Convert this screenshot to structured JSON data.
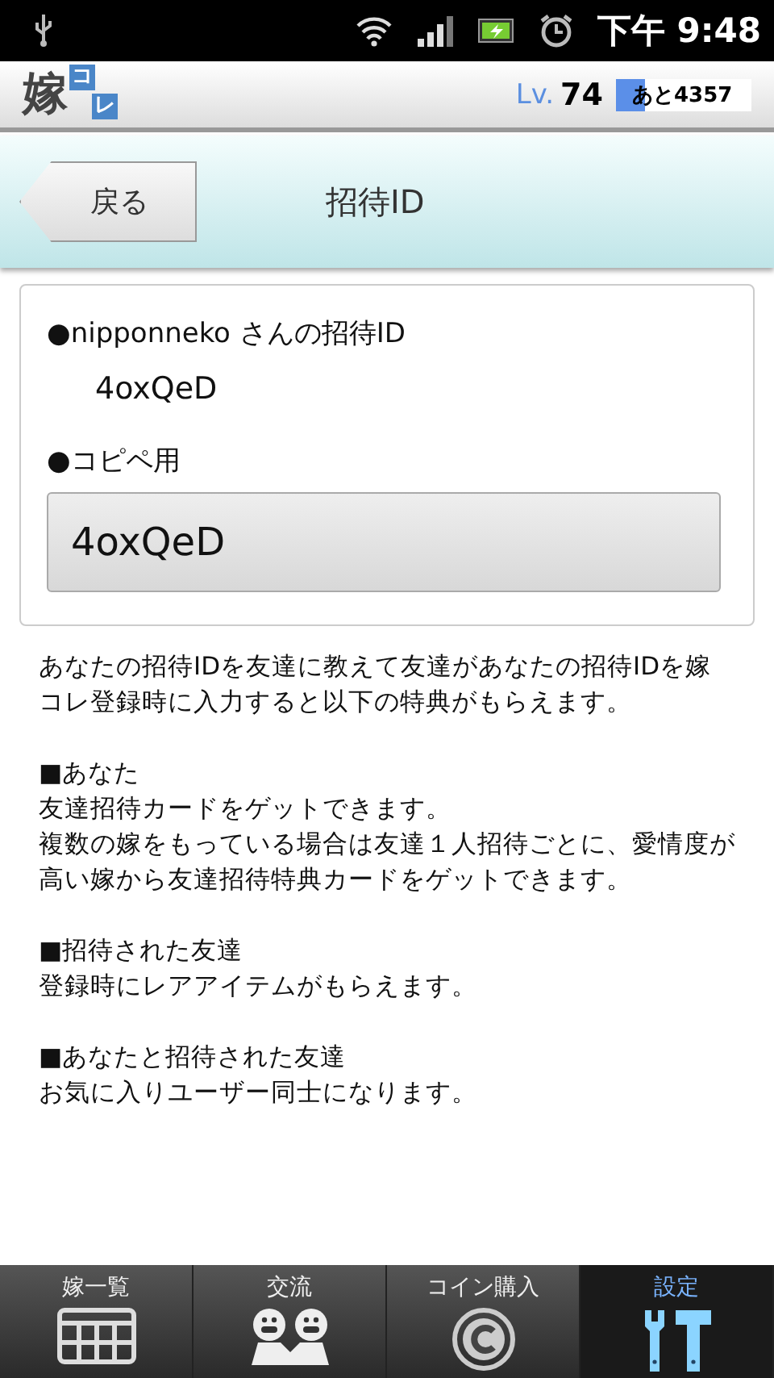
{
  "status_bar": {
    "time": "下午 9:48"
  },
  "header": {
    "logo_main": "嫁",
    "logo_tiles": [
      "コ",
      "レ"
    ],
    "level_label": "Lv.",
    "level_value": "74",
    "exp": {
      "text": "あと4357",
      "level": 0.22
    }
  },
  "title_bar": {
    "back": "戻る",
    "title": "招待ID"
  },
  "card": {
    "id_label": "●nipponneko さんの招待ID",
    "id_value": "4oxQeD",
    "copy_label": "●コピペ用",
    "copy_value": "4oxQeD"
  },
  "sections": [
    {
      "lines": [
        "あなたの招待IDを友達に教えて友達があなたの招待IDを嫁コレ登録時に入力すると以下の特典がもらえます。"
      ]
    },
    {
      "lines": [
        "■あなた",
        "友達招待カードをゲットできます。",
        "複数の嫁をもっている場合は友達１人招待ごとに、愛情度が高い嫁から友達招待特典カードをゲットできます。"
      ]
    },
    {
      "lines": [
        "■招待された友達",
        "登録時にレアアイテムがもらえます。"
      ]
    },
    {
      "lines": [
        "■あなたと招待された友達",
        "お気に入りユーザー同士になります。"
      ]
    }
  ],
  "nav": [
    {
      "label": "嫁一覧",
      "kind": "grid",
      "selected": false
    },
    {
      "label": "交流",
      "kind": "people",
      "selected": false
    },
    {
      "label": "コイン購入",
      "kind": "coin",
      "selected": false
    },
    {
      "label": "設定",
      "kind": "tools",
      "selected": true
    }
  ]
}
